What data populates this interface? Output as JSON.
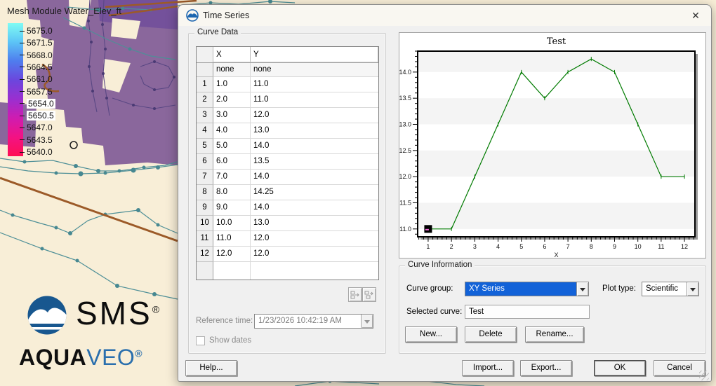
{
  "map": {
    "title": "Mesh Module Water_Elev_ft",
    "legend": {
      "values": [
        "5675.0",
        "5671.5",
        "5668.0",
        "5664.5",
        "5661.0",
        "5657.5",
        "5654.0",
        "5650.5",
        "5647.0",
        "5643.5",
        "5640.0"
      ],
      "boxed_values": [
        "5654.0",
        "5650.5"
      ],
      "gradient": [
        "#80fbf3",
        "#5cc4f6",
        "#4f7cee",
        "#6b46dd",
        "#9a2fd0",
        "#cf1cb0",
        "#f31283",
        "#ff0f55"
      ]
    },
    "logo": {
      "sms": "SMS",
      "aqua": "AQUA",
      "veo": "VEO",
      "reg": "®"
    }
  },
  "dialog": {
    "title": "Time Series",
    "close_glyph": "✕",
    "curve_data": {
      "label": "Curve Data",
      "table": {
        "columns": [
          "X",
          "Y"
        ],
        "units": [
          "none",
          "none"
        ],
        "rows": [
          [
            "1",
            "1.0",
            "11.0"
          ],
          [
            "2",
            "2.0",
            "11.0"
          ],
          [
            "3",
            "3.0",
            "12.0"
          ],
          [
            "4",
            "4.0",
            "13.0"
          ],
          [
            "5",
            "5.0",
            "14.0"
          ],
          [
            "6",
            "6.0",
            "13.5"
          ],
          [
            "7",
            "7.0",
            "14.0"
          ],
          [
            "8",
            "8.0",
            "14.25"
          ],
          [
            "9",
            "9.0",
            "14.0"
          ],
          [
            "10",
            "10.0",
            "13.0"
          ],
          [
            "11",
            "11.0",
            "12.0"
          ],
          [
            "12",
            "12.0",
            "12.0"
          ]
        ]
      },
      "reference_time_label": "Reference time:",
      "reference_time_value": "1/23/2026 10:42:19 AM",
      "show_dates_label": "Show dates"
    },
    "curve_information": {
      "label": "Curve Information",
      "curve_group_label": "Curve group:",
      "curve_group_value": "XY Series",
      "plot_type_label": "Plot type:",
      "plot_type_value": "Scientific",
      "selected_curve_label": "Selected curve:",
      "selected_curve_value": "Test",
      "buttons": {
        "new": "New...",
        "delete": "Delete",
        "rename": "Rename..."
      }
    },
    "footer_buttons": {
      "help": "Help...",
      "import": "Import...",
      "export": "Export...",
      "ok": "OK",
      "cancel": "Cancel"
    }
  },
  "chart_data": {
    "type": "line",
    "title": "Test",
    "xlabel": "X",
    "x": [
      1,
      2,
      3,
      4,
      5,
      6,
      7,
      8,
      9,
      10,
      11,
      12
    ],
    "y": [
      11.0,
      11.0,
      12.0,
      13.0,
      14.0,
      13.5,
      14.0,
      14.25,
      14.0,
      13.0,
      12.0,
      12.0
    ],
    "series_name": "Test",
    "xlim": [
      0.55,
      12.45
    ],
    "ylim": [
      10.85,
      14.4
    ],
    "xticks": [
      1,
      2,
      3,
      4,
      5,
      6,
      7,
      8,
      9,
      10,
      11,
      12
    ],
    "yticks": [
      11.0,
      11.5,
      12.0,
      12.5,
      13.0,
      13.5,
      14.0
    ],
    "x_minor_step": 0.2,
    "y_minor_step": 0.1,
    "line_color": "#007b00",
    "band_color": "#f4f4f4",
    "selected_point": {
      "x": 1,
      "y": 11.0
    },
    "legend_position": "none",
    "grid": "alternating-horizontal-bands"
  }
}
